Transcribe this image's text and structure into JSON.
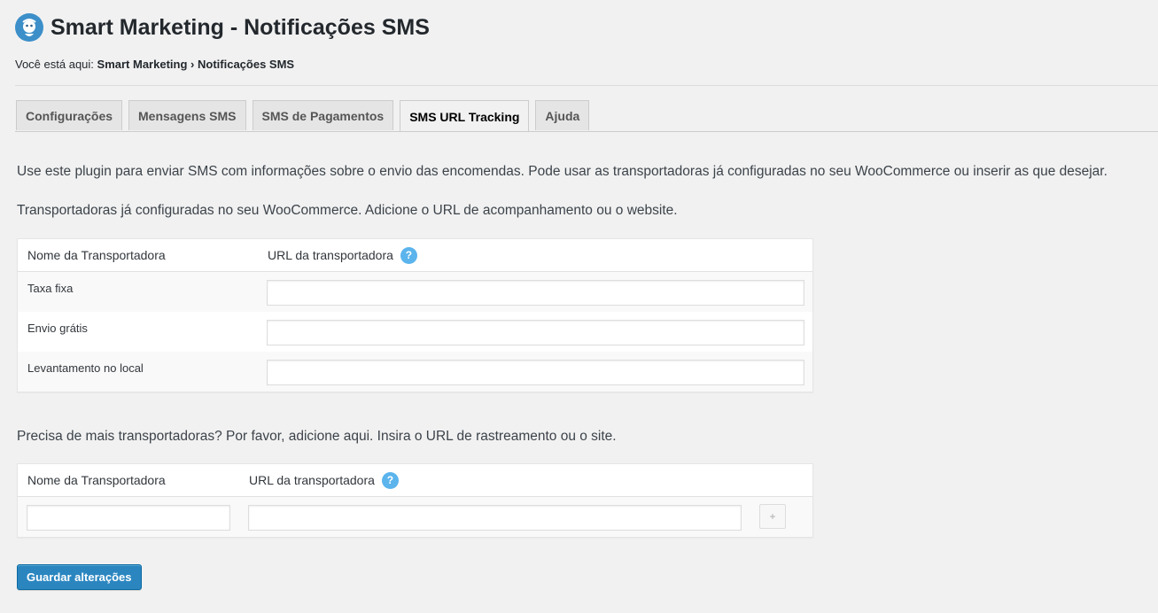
{
  "header": {
    "title": "Smart Marketing - Notificações SMS"
  },
  "breadcrumb": {
    "prefix": "Você está aqui:",
    "crumb1": "Smart Marketing",
    "separator": "›",
    "crumb2": "Notificações SMS"
  },
  "tabs": [
    {
      "label": "Configurações",
      "active": false
    },
    {
      "label": "Mensagens SMS",
      "active": false
    },
    {
      "label": "SMS de Pagamentos",
      "active": false
    },
    {
      "label": "SMS URL Tracking",
      "active": true
    },
    {
      "label": "Ajuda",
      "active": false
    }
  ],
  "intro_text": "Use este plugin para enviar SMS com informações sobre o envio das encomendas. Pode usar as transportadoras já configuradas no seu WooCommerce ou inserir as que desejar.",
  "configured_text": "Transportadoras já configuradas no seu WooCommerce. Adicione o URL de acompanhamento ou o website.",
  "configured_table": {
    "col_name": "Nome da Transportadora",
    "col_url": "URL da transportadora",
    "help_icon": "?",
    "rows": [
      {
        "name": "Taxa fixa",
        "url": ""
      },
      {
        "name": "Envio grátis",
        "url": ""
      },
      {
        "name": "Levantamento no local",
        "url": ""
      }
    ]
  },
  "more_text": "Precisa de mais transportadoras? Por favor, adicione aqui. Insira o URL de rastreamento ou o site.",
  "custom_table": {
    "col_name": "Nome da Transportadora",
    "col_url": "URL da transportadora",
    "help_icon": "?",
    "name_value": "",
    "url_value": "",
    "add_label": "+"
  },
  "save_label": "Guardar alterações",
  "colors": {
    "primary": "#2b86c0",
    "help": "#5bb4ec",
    "background": "#f1f1f1"
  },
  "icons": {
    "logo": "mascot-logo-icon",
    "help": "help-question-icon",
    "add": "plus-icon"
  }
}
